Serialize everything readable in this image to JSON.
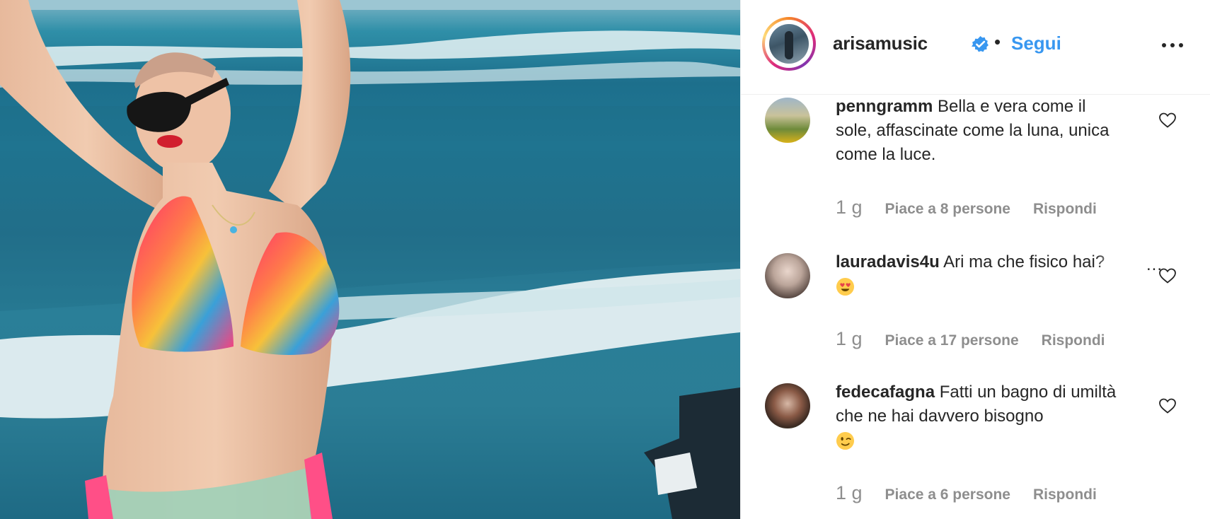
{
  "post_header": {
    "username": "arisamusic",
    "separator": "•",
    "follow_label": "Segui",
    "verified": true
  },
  "comments": [
    {
      "username": "penngramm",
      "text": "Bella e vera come il sole, affascinate come la luna, unica come la luce.",
      "time": "1 g",
      "likes": "Piace a 8 persone",
      "reply": "Rispondi"
    },
    {
      "username": "lauradavis4u",
      "text": "Ari ma che fisico hai?",
      "more": "...",
      "emoji": "heart-eyes",
      "time": "1 g",
      "likes": "Piace a 17 persone",
      "reply": "Rispondi"
    },
    {
      "username": "fedecafagna",
      "text": "Fatti un bagno di umiltà che ne hai davvero bisogno",
      "emoji": "winking-face",
      "time": "1 g",
      "likes": "Piace a 6 persone",
      "reply": "Rispondi"
    }
  ],
  "colors": {
    "link_blue": "#3897f0",
    "text": "#262626",
    "muted": "#8e8e8e"
  },
  "icons": [
    "verified-badge-icon",
    "more-options-icon",
    "heart-icon"
  ]
}
